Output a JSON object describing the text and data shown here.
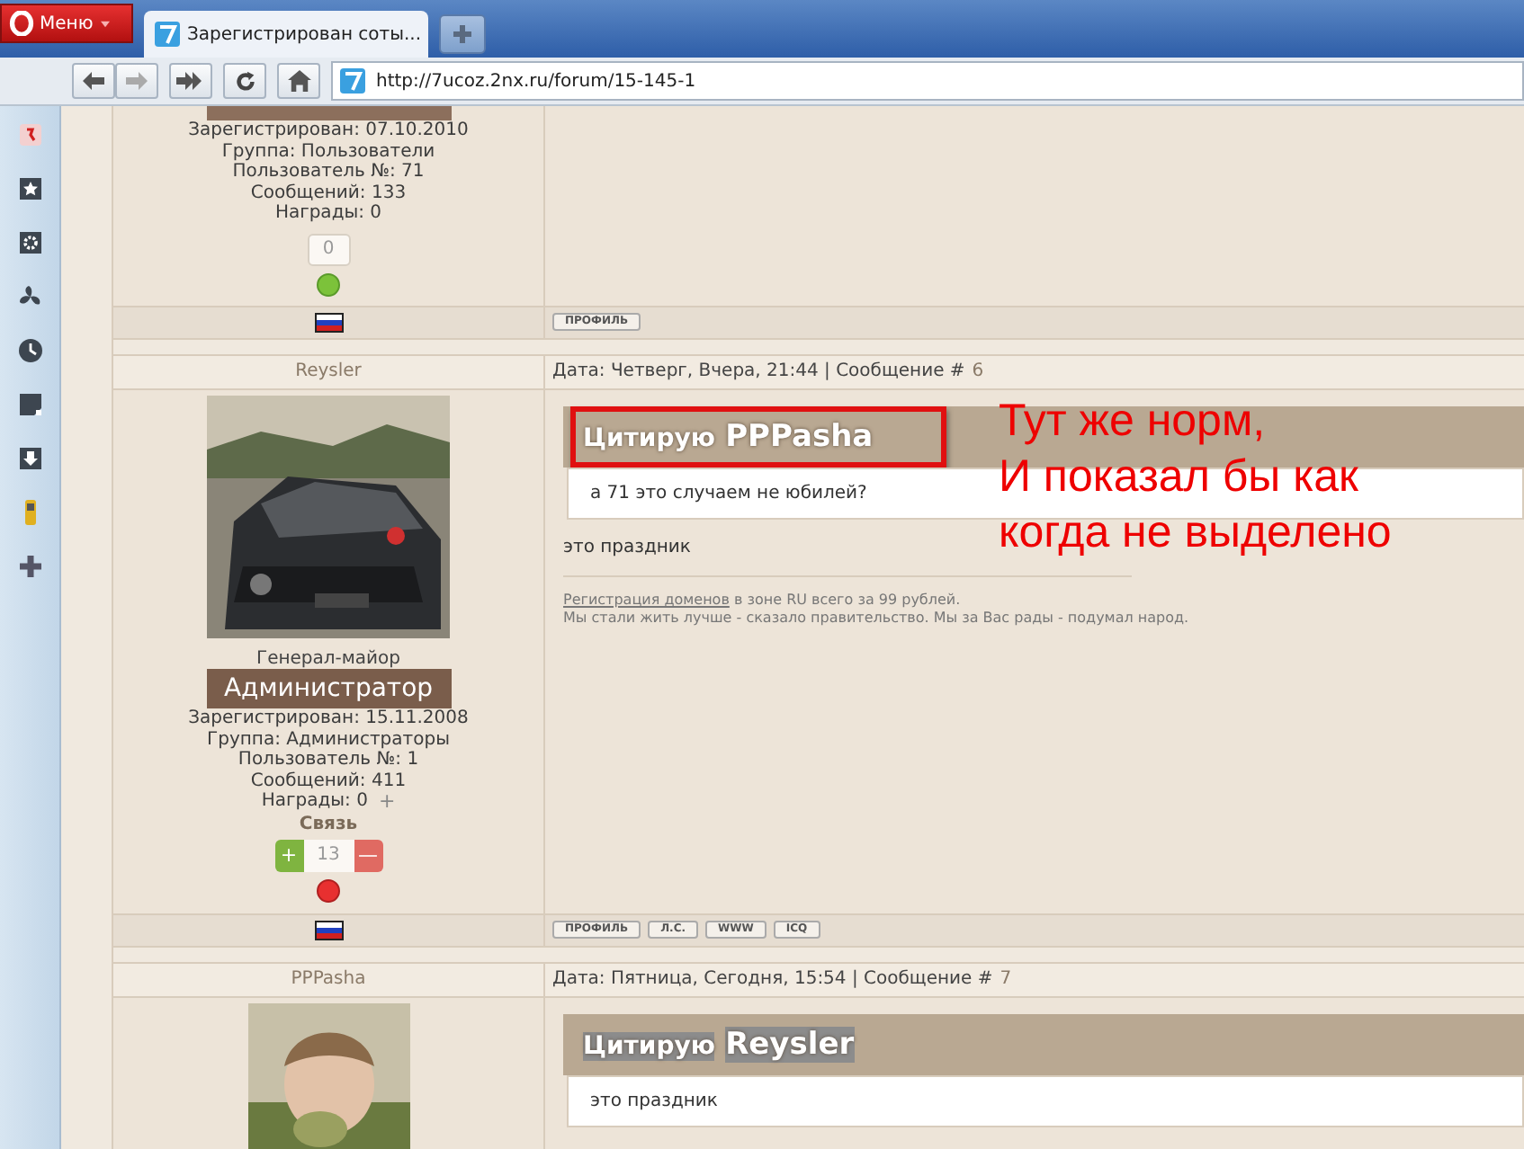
{
  "browser": {
    "menu_label": "Меню",
    "tab": {
      "title": "Зарегистрирован соты...",
      "selected": true
    },
    "url": "http://7ucoz.2nx.ru/forum/15-145-1"
  },
  "posts": [
    {
      "kind": "partial",
      "info": [
        "Зарегистрирован: 07.10.2010",
        "Группа: Пользователи",
        "Пользователь №: 71",
        "Сообщений: 133"
      ],
      "awards": "Награды: 0",
      "rating": {
        "kind": "plain",
        "value": "0"
      },
      "online": true,
      "buttons": [
        "ПРОФИЛЬ"
      ]
    },
    {
      "kind": "full",
      "author": "Reysler",
      "date": "Дата: Четверг, Вчера, 21:44 | Сообщение #",
      "number": "6",
      "rank": "Генерал-майор",
      "group_badge": "Администратор",
      "info": [
        "Зарегистрирован: 15.11.2008",
        "Группа: Администраторы",
        "Пользователь №: 1",
        "Сообщений: 411"
      ],
      "awards": "Награды: 0",
      "awards_add": "+",
      "contact": "Связь",
      "rating": {
        "kind": "vote",
        "value": "13",
        "plus": "+",
        "minus": "—"
      },
      "online": false,
      "quote": {
        "label": "Цитирую",
        "author": "PPPasha",
        "text": "а 71 это случаем не юбилей?",
        "text_selected": false,
        "marked": true
      },
      "text": "это праздник",
      "signature": {
        "link": "Регистрация доменов",
        "rest": "в зоне RU всего за 99 рублей.",
        "line2": "Мы стали жить лучше - сказало правительство. Мы за Вас рады - подумал народ."
      },
      "buttons": [
        "ПРОФИЛЬ",
        "Л.С.",
        "WWW",
        "ICQ"
      ]
    },
    {
      "kind": "full",
      "author": "PPPasha",
      "date": "Дата: Пятница, Сегодня, 15:54 | Сообщение #",
      "number": "7",
      "quote": {
        "label": "Цитирую",
        "author": "Reysler",
        "text": "это праздник",
        "text_selected": true,
        "marked": false
      }
    }
  ],
  "annotation": {
    "lines": [
      "Тут же норм,",
      "И показал бы как",
      "когда не выделено"
    ]
  }
}
